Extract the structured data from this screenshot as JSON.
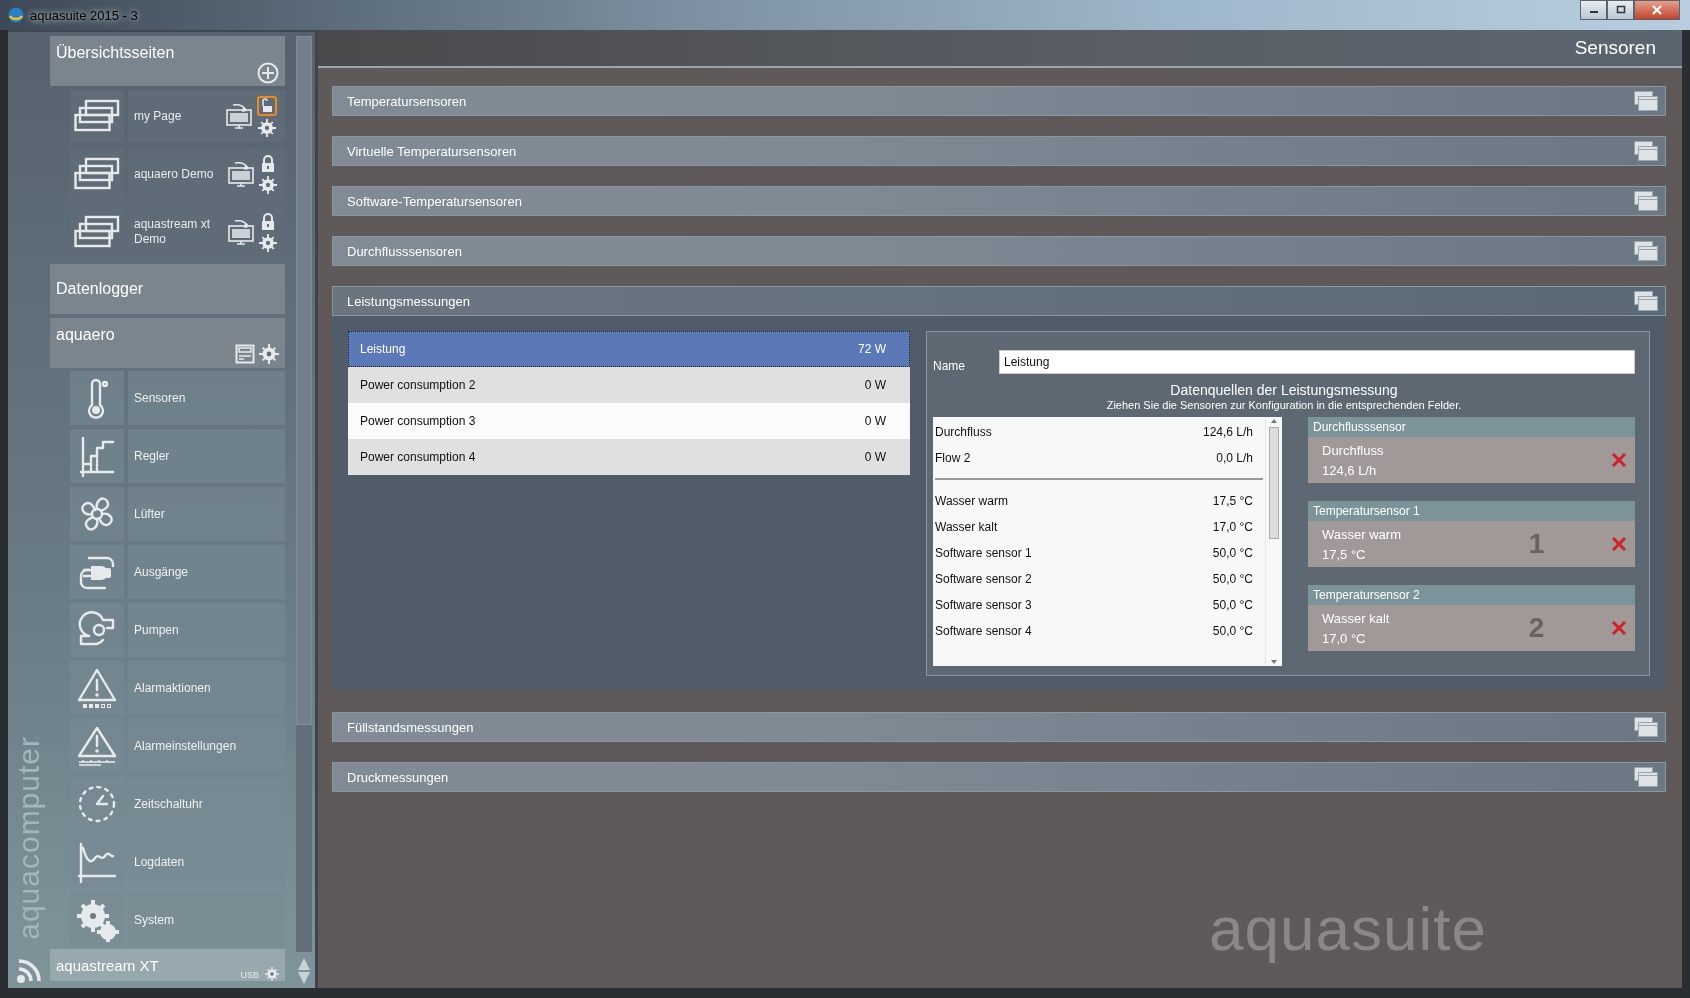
{
  "window": {
    "title": "aquasuite 2015 - 3"
  },
  "sidebar": {
    "brand": "aquacomputer",
    "overview": {
      "title": "Übersichtsseiten",
      "pages": [
        {
          "label": "my Page",
          "locked": false
        },
        {
          "label": "aquaero Demo",
          "locked": true
        },
        {
          "label": "aquastream xt Demo",
          "locked": true
        }
      ]
    },
    "datalogger": "Datenlogger",
    "device": {
      "title": "aquaero",
      "items": [
        {
          "label": "Sensoren",
          "kind": "sensors"
        },
        {
          "label": "Regler",
          "kind": "controllers"
        },
        {
          "label": "Lüfter",
          "kind": "fans"
        },
        {
          "label": "Ausgänge",
          "kind": "outputs"
        },
        {
          "label": "Pumpen",
          "kind": "pumps"
        },
        {
          "label": "Alarmaktionen",
          "kind": "alarm_actions"
        },
        {
          "label": "Alarmeinstellungen",
          "kind": "alarm_settings"
        },
        {
          "label": "Zeitschaltuhr",
          "kind": "timer"
        },
        {
          "label": "Logdaten",
          "kind": "logdata"
        },
        {
          "label": "System",
          "kind": "system"
        }
      ]
    },
    "footer_device": {
      "title": "aquastream XT",
      "connection": "USB"
    }
  },
  "main": {
    "title": "Sensoren",
    "logo": "aquasuite",
    "sections": [
      {
        "title": "Temperatursensoren",
        "expanded": false
      },
      {
        "title": "Virtuelle Temperatursensoren",
        "expanded": false
      },
      {
        "title": "Software-Temperatursensoren",
        "expanded": false
      },
      {
        "title": "Durchflusssensoren",
        "expanded": false
      },
      {
        "title": "Leistungsmessungen",
        "expanded": true
      },
      {
        "title": "Füllstandsmessungen",
        "expanded": false
      },
      {
        "title": "Druckmessungen",
        "expanded": false
      }
    ],
    "power": {
      "rows": [
        {
          "name": "Leistung",
          "value": "72 W",
          "selected": true
        },
        {
          "name": "Power consumption 2",
          "value": "0 W",
          "selected": false
        },
        {
          "name": "Power consumption 3",
          "value": "0 W",
          "selected": false
        },
        {
          "name": "Power consumption 4",
          "value": "0 W",
          "selected": false
        }
      ],
      "name_label": "Name",
      "name_value": "Leistung",
      "sources_title": "Datenquellen der Leistungsmessung",
      "sources_hint": "Ziehen Sie die Sensoren zur Konfiguration in die entsprechenden Felder.",
      "sensor_groups": [
        [
          {
            "name": "Durchfluss",
            "value": "124,6 L/h"
          },
          {
            "name": "Flow 2",
            "value": "0,0 L/h"
          }
        ],
        [
          {
            "name": "Wasser warm",
            "value": "17,5 °C"
          },
          {
            "name": "Wasser kalt",
            "value": "17,0 °C"
          },
          {
            "name": "Software sensor 1",
            "value": "50,0 °C"
          },
          {
            "name": "Software sensor 2",
            "value": "50,0 °C"
          },
          {
            "name": "Software sensor 3",
            "value": "50,0 °C"
          },
          {
            "name": "Software sensor 4",
            "value": "50,0 °C"
          }
        ]
      ],
      "slots": [
        {
          "title": "Durchflusssensor",
          "sensor": "Durchfluss",
          "value": "124,6 L/h"
        },
        {
          "title": "Temperatursensor 1",
          "sensor": "Wasser warm",
          "value": "17,5 °C",
          "number": "1"
        },
        {
          "title": "Temperatursensor 2",
          "sensor": "Wasser kalt",
          "value": "17,0 °C",
          "number": "2"
        }
      ]
    }
  }
}
